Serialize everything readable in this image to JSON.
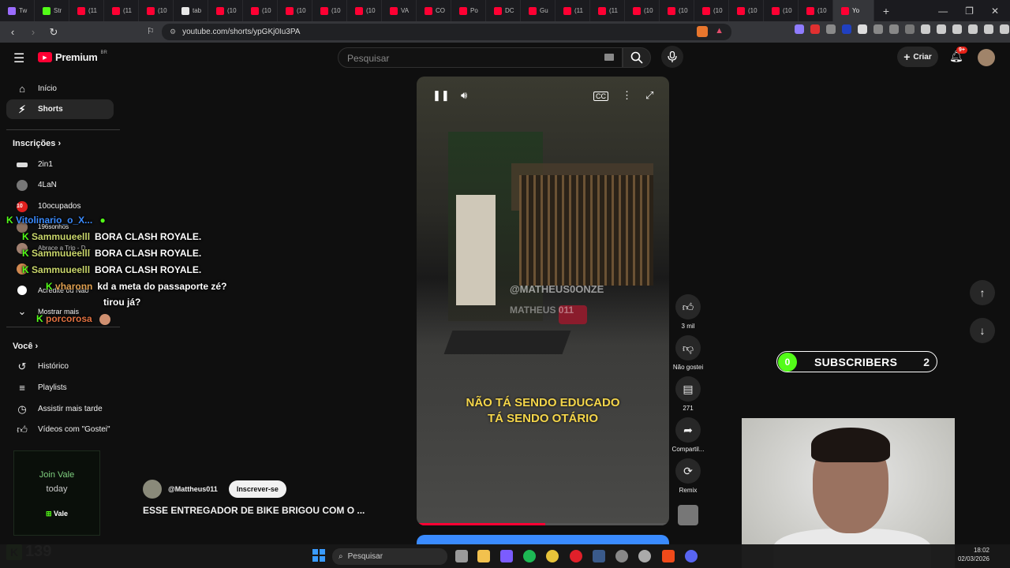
{
  "browser": {
    "tabs": [
      {
        "label": "Tw",
        "color": "#9b6cff"
      },
      {
        "label": "Str",
        "color": "#53fc18"
      },
      {
        "label": "(11",
        "color": "#ff0033"
      },
      {
        "label": "(11",
        "color": "#ff0033"
      },
      {
        "label": "(10",
        "color": "#ff0033"
      },
      {
        "label": "tab",
        "color": "#e8e8e8"
      },
      {
        "label": "(10",
        "color": "#ff0033"
      },
      {
        "label": "(10",
        "color": "#ff0033"
      },
      {
        "label": "(10",
        "color": "#ff0033"
      },
      {
        "label": "(10",
        "color": "#ff0033"
      },
      {
        "label": "(10",
        "color": "#ff0033"
      },
      {
        "label": "VA",
        "color": "#ff0033"
      },
      {
        "label": "CO",
        "color": "#ff0033"
      },
      {
        "label": "Po",
        "color": "#ff0033"
      },
      {
        "label": "DC",
        "color": "#ff0033"
      },
      {
        "label": "Gu",
        "color": "#ff0033"
      },
      {
        "label": "(11",
        "color": "#ff0033"
      },
      {
        "label": "(11",
        "color": "#ff0033"
      },
      {
        "label": "(10",
        "color": "#ff0033"
      },
      {
        "label": "(10",
        "color": "#ff0033"
      },
      {
        "label": "(10",
        "color": "#ff0033"
      },
      {
        "label": "(10",
        "color": "#ff0033"
      },
      {
        "label": "(10",
        "color": "#ff0033"
      },
      {
        "label": "(10",
        "color": "#ff0033"
      },
      {
        "label": "Yo",
        "color": "#ff0033"
      }
    ],
    "url": "youtube.com/shorts/ypGKj0Iu3PA"
  },
  "masthead": {
    "logo": "Premium",
    "logo_region": "BR",
    "search_placeholder": "Pesquisar",
    "create_label": "Criar",
    "notif_badge": "9+"
  },
  "sidebar": {
    "home": "Início",
    "shorts": "Shorts",
    "subs_heading": "Inscrições",
    "subs": [
      "2in1",
      "4LaN",
      "10ocupados",
      "196sonhos",
      "Abrace a Trip - D...",
      "",
      "Acredite ou Não",
      "Mostrar mais"
    ],
    "you_heading": "Você",
    "you_items": [
      "Histórico",
      "Playlists",
      "Assistir mais tarde",
      "Vídeos com \"Gostei\""
    ]
  },
  "chat": {
    "messages": [
      {
        "user": "Vitolinario_o_X...",
        "msg": ""
      },
      {
        "user": "Sammuueelll",
        "msg": "BORA CLASH ROYALE."
      },
      {
        "user": "Sammuueelll",
        "msg": "BORA CLASH ROYALE."
      },
      {
        "user": "Sammuueelll",
        "msg": "BORA CLASH ROYALE."
      },
      {
        "user": "vharonn",
        "msg": "kd a meta do passaporte zé?"
      },
      {
        "user": "",
        "msg": "tirou já?"
      },
      {
        "user": "porcorosa",
        "msg": ""
      }
    ]
  },
  "video": {
    "caption_line1": "NÃO TÁ SENDO EDUCADO",
    "caption_line2": "TÁ SENDO OTÁRIO",
    "watermark1": "@MATHEUS0ONZE",
    "watermark2": "MATHEUS 011",
    "channel": "@Mattheus011",
    "subscribe_label": "Inscrever-se",
    "title": "ESSE ENTREGADOR DE BIKE BRIGOU COM O ..."
  },
  "actions": {
    "like": "3 mil",
    "dislike": "Não gostei",
    "comments": "271",
    "share": "Compartil...",
    "remix": "Remix"
  },
  "subs_widget": {
    "count_left": "0",
    "label": "SUBSCRIBERS",
    "count_right": "2"
  },
  "ad": {
    "line1": "Join Vale",
    "line2": "today",
    "brand": "Vale"
  },
  "kick_counter": "139",
  "taskbar": {
    "search": "Pesquisar",
    "time": "18:02",
    "date": "02/03/2026"
  }
}
